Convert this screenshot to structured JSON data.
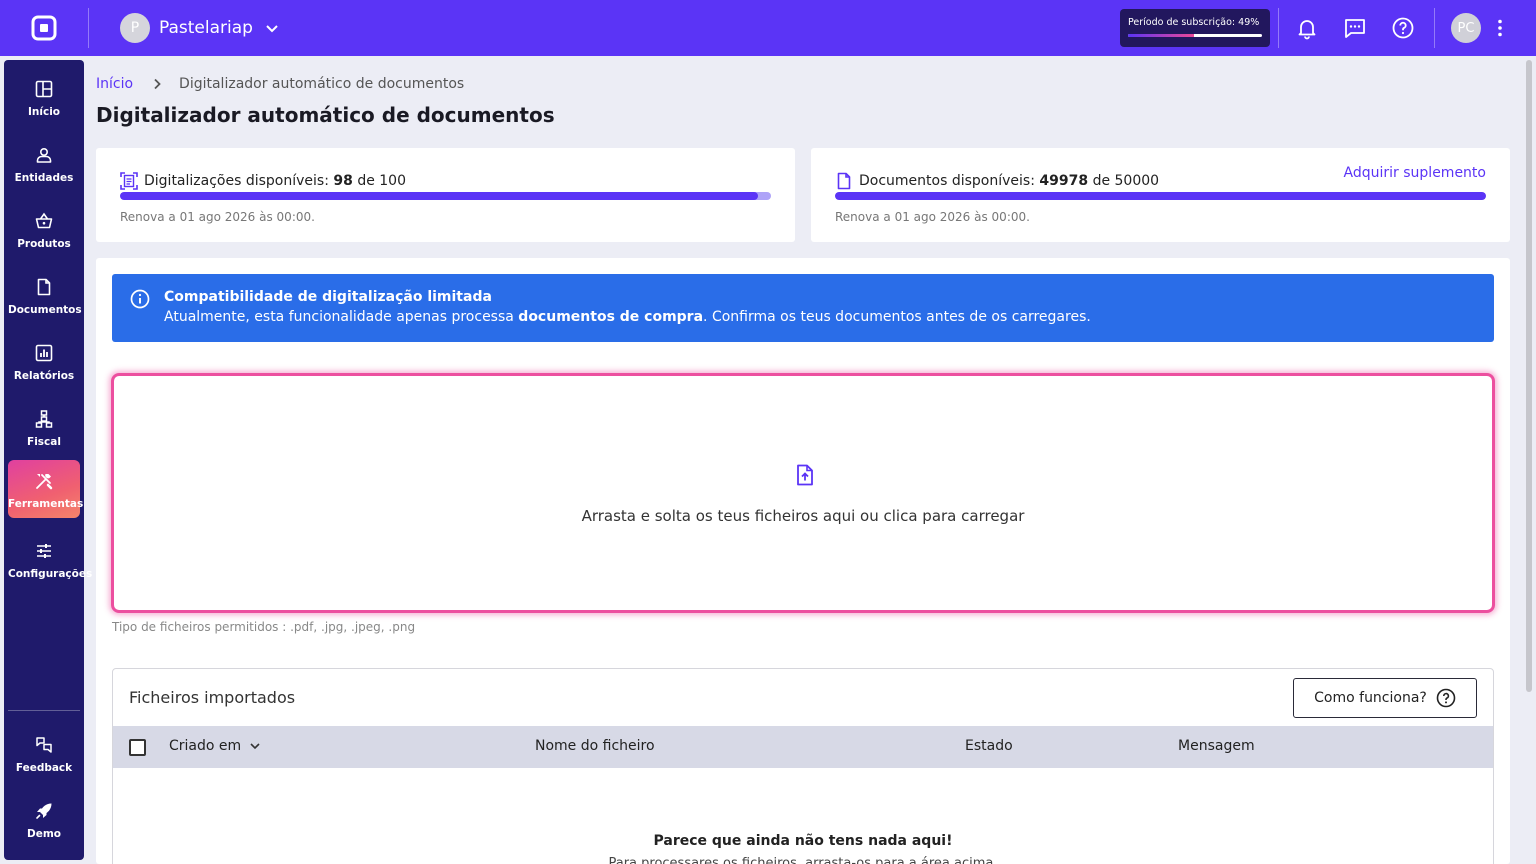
{
  "topbar": {
    "company_initial": "P",
    "company_name": "Pastelariap",
    "subscription_label": "Período de subscrição: 49%",
    "subscription_progress": 0.49,
    "user_initials": "PC",
    "accent_color": "#5b34f6"
  },
  "sidebar": {
    "items": [
      {
        "label": "Início",
        "icon": "dashboard-icon"
      },
      {
        "label": "Entidades",
        "icon": "person-icon"
      },
      {
        "label": "Produtos",
        "icon": "basket-icon"
      },
      {
        "label": "Documentos",
        "icon": "document-icon"
      },
      {
        "label": "Relatórios",
        "icon": "chart-icon"
      },
      {
        "label": "Fiscal",
        "icon": "hierarchy-icon"
      },
      {
        "label": "Ferramentas",
        "icon": "tools-icon"
      },
      {
        "label": "Configurações",
        "icon": "sliders-icon"
      }
    ],
    "active": "Ferramentas",
    "bottom_items": [
      {
        "label": "Feedback",
        "icon": "feedback-icon"
      },
      {
        "label": "Demo",
        "icon": "rocket-icon"
      }
    ]
  },
  "breadcrumb": {
    "home": "Início",
    "current": "Digitalizador automático de documentos"
  },
  "page_title": "Digitalizador automático de documentos",
  "scans": {
    "label": "Digitalizações disponíveis:",
    "used": "98",
    "of_text": "de 100",
    "progress": 0.98,
    "renew": "Renova a 01 ago 2026 às 00:00."
  },
  "docs": {
    "label": "Documentos disponíveis:",
    "used": "49978",
    "of_text": "de 50000",
    "progress": 0.9996,
    "renew": "Renova a 01 ago 2026 às 00:00.",
    "addon_link": "Adquirir suplemento"
  },
  "info": {
    "title": "Compatibilidade de digitalização limitada",
    "text_before": "Atualmente, esta funcionalidade apenas processa ",
    "text_bold": "documentos de compra",
    "text_after": ". Confirma os teus documentos antes de os carregares."
  },
  "dropzone": {
    "text": "Arrasta e solta os teus ficheiros aqui ou clica para carregar",
    "allowed": "Tipo de ficheiros permitidos : .pdf, .jpg, .jpeg, .png"
  },
  "files": {
    "title": "Ficheiros importados",
    "how_button": "Como funciona?",
    "columns": [
      "Criado em",
      "Nome do ficheiro",
      "Estado",
      "Mensagem"
    ],
    "empty_title": "Parece que ainda não tens nada aqui!",
    "empty_text": "Para processares os ficheiros, arrasta-os para a área acima."
  }
}
